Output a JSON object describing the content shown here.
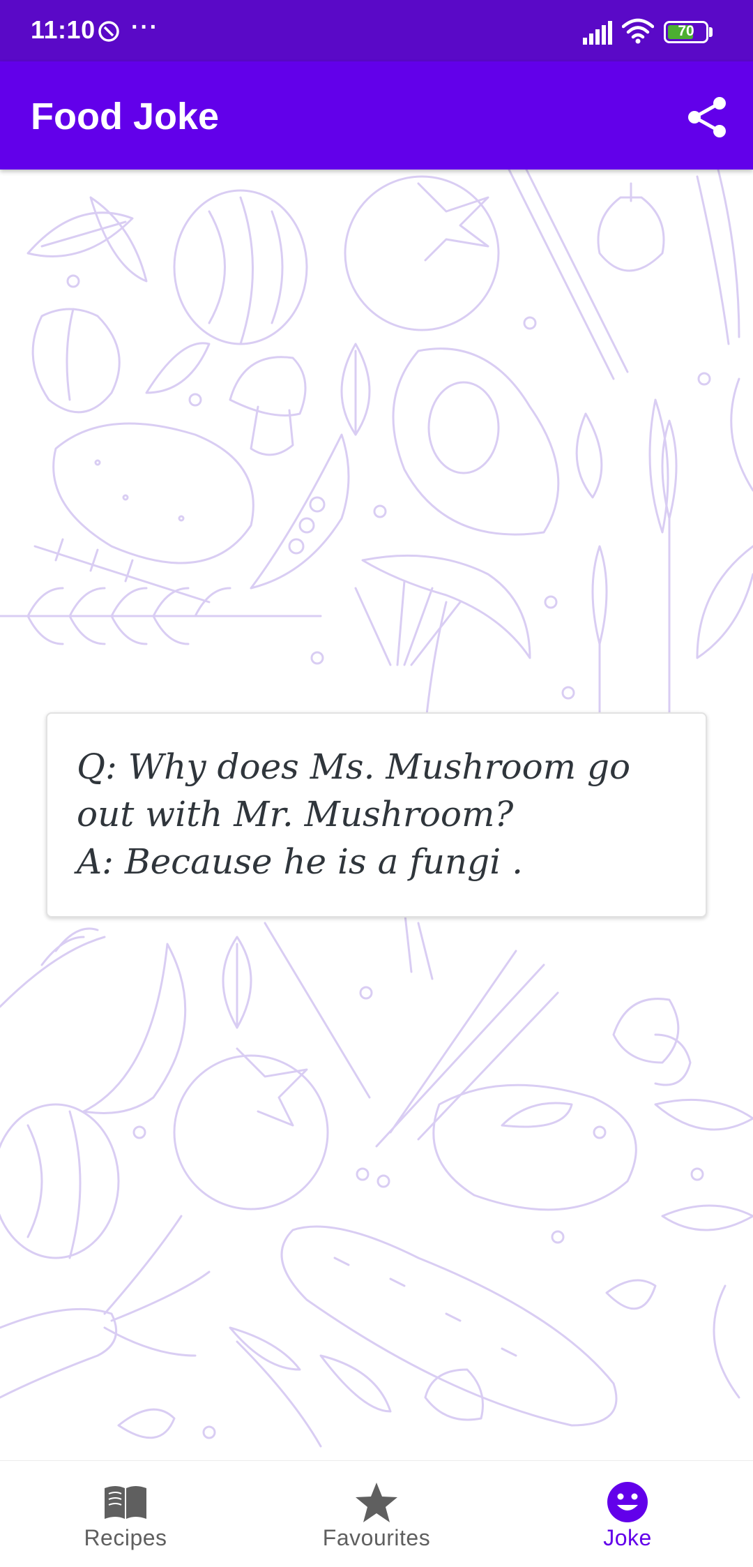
{
  "status_bar": {
    "time": "11:10",
    "dots": "···",
    "battery": "70",
    "battery_level": 0.7,
    "icons": [
      "do-not-disturb-icon",
      "more-dots-icon",
      "signal-icon",
      "wifi-icon",
      "battery-icon"
    ]
  },
  "app_bar": {
    "title": "Food Joke",
    "share_icon": "share-icon"
  },
  "joke": {
    "text": "Q: Why does Ms. Mushroom go out with Mr. Mushroom?\nA: Because he is a fungi ."
  },
  "bottom_nav": {
    "items": [
      {
        "label": "Recipes",
        "icon": "book-icon",
        "active": false
      },
      {
        "label": "Favourites",
        "icon": "star-icon",
        "active": false
      },
      {
        "label": "Joke",
        "icon": "smiley-icon",
        "active": true
      }
    ]
  },
  "colors": {
    "status_bar": "#5a09c7",
    "app_bar": "#6200ea",
    "accent": "#6200ea",
    "doodle": "#d7c8f3",
    "joke_text": "#2f353b",
    "inactive_nav": "#5f5f5f"
  }
}
